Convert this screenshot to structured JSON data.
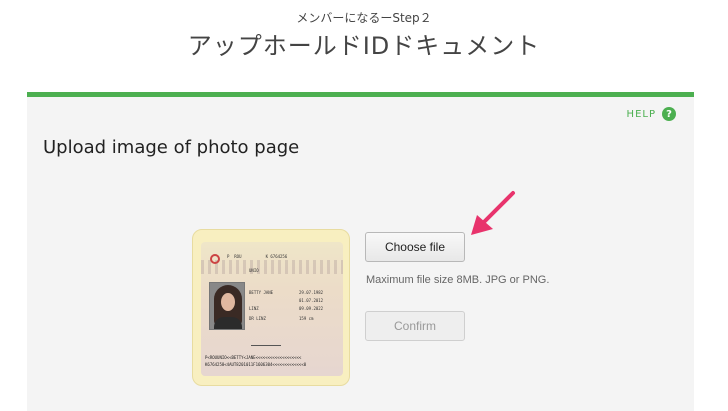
{
  "header": {
    "step": "メンバーになるーStep２",
    "title": "アップホールドIDドキュメント"
  },
  "help": {
    "label": "HELP",
    "icon_glyph": "?"
  },
  "upload": {
    "title": "Upload image of photo page",
    "choose_label": "Choose file",
    "file_hint": "Maximum file size 8MB. JPG or PNG.",
    "confirm_label": "Confirm"
  },
  "passport": {
    "lines_top": [
      "P",
      "ROU",
      "K 6764256"
    ],
    "name": "BETTY JANE",
    "surname": "UNIO",
    "dob": "29.07.1982",
    "issue": "01.07.2012",
    "expiry": "09.09.2022",
    "place": "LINZ",
    "authority": "DR LINZ",
    "height": "159 cm",
    "mrz1": "P<ROUUNIO<<BETTY<JANE<<<<<<<<<<<<<<<<<<<",
    "mrz2": "K6764258<4AUT8201011F1606304<<<<<<<<<<<<<0"
  },
  "colors": {
    "accent": "#4caf50",
    "arrow": "#e8336c"
  },
  "icons": {
    "help": "question-circle-icon",
    "arrow": "pointer-arrow-icon"
  }
}
